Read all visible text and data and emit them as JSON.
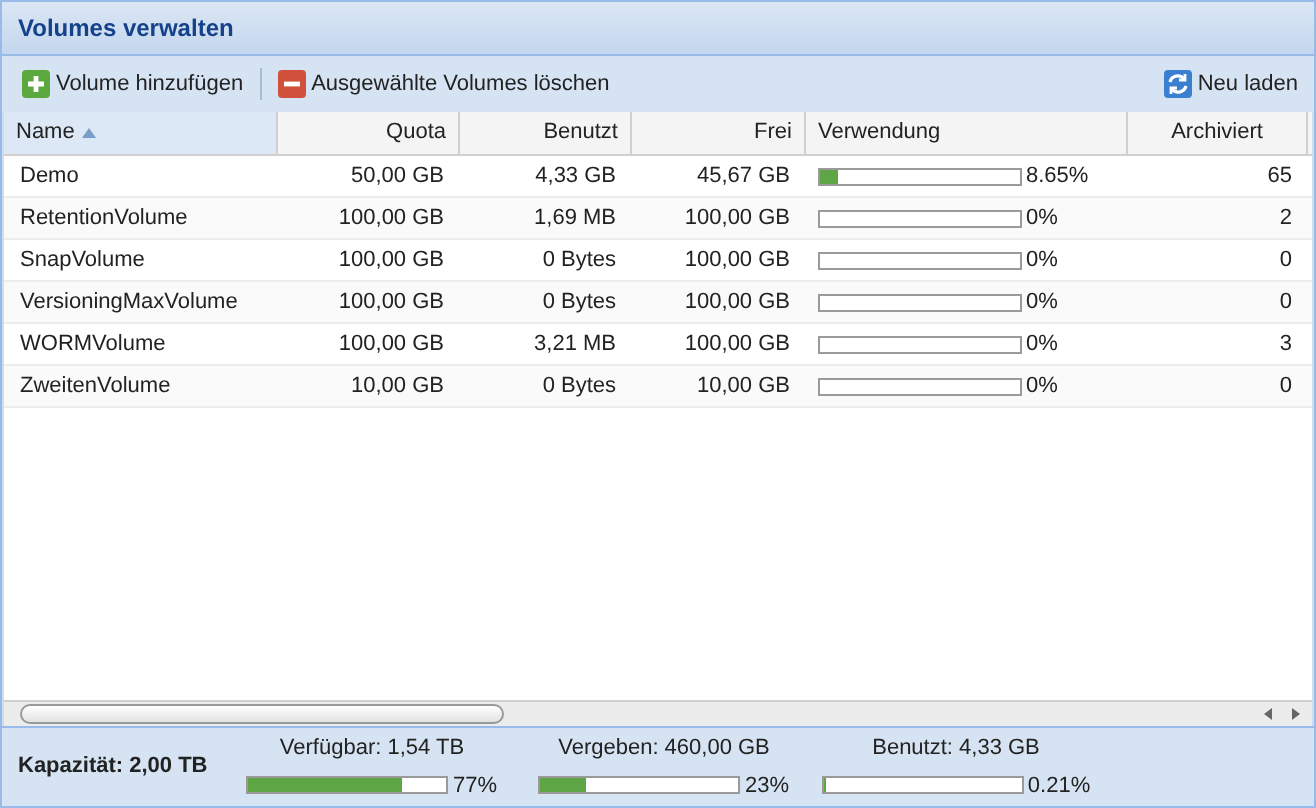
{
  "panel": {
    "title": "Volumes verwalten"
  },
  "toolbar": {
    "buttons": [
      {
        "kind": "add",
        "label": "Volume hinzufügen"
      },
      {
        "kind": "delete",
        "label": "Ausgewählte Volumes löschen"
      }
    ],
    "reload": {
      "label": "Neu laden"
    }
  },
  "table": {
    "columns": [
      {
        "label": "Name",
        "sorted": true
      },
      {
        "label": "Quota",
        "sorted": false
      },
      {
        "label": "Benutzt",
        "sorted": false
      },
      {
        "label": "Frei",
        "sorted": false
      },
      {
        "label": "Verwendung",
        "sorted": false
      },
      {
        "label": "Archiviert",
        "sorted": false
      }
    ],
    "rows": [
      {
        "name": "Demo",
        "quota": "50,00 GB",
        "used": "4,33 GB",
        "free": "45,67 GB",
        "level": 0.0865,
        "usage": "8.65%",
        "archived": "65"
      },
      {
        "name": "RetentionVolume",
        "quota": "100,00 GB",
        "used": "1,69 MB",
        "free": "100,00 GB",
        "usage": "0%",
        "archived": "2"
      },
      {
        "name": "SnapVolume",
        "quota": "100,00 GB",
        "used": "0 Bytes",
        "free": "100,00 GB",
        "usage": "0%",
        "archived": "0"
      },
      {
        "name": "VersioningMaxVolume",
        "quota": "100,00 GB",
        "used": "0 Bytes",
        "free": "100,00 GB",
        "usage": "0%",
        "archived": "0"
      },
      {
        "name": "WORMVolume",
        "quota": "100,00 GB",
        "used": "3,21 MB",
        "free": "100,00 GB",
        "usage": "0%",
        "archived": "3"
      },
      {
        "name": "ZweitenVolume",
        "quota": "10,00 GB",
        "used": "0 Bytes",
        "free": "10,00 GB",
        "usage": "0%",
        "archived": "0"
      }
    ]
  },
  "footer": {
    "capacity": "Kapazität: 2,00 TB",
    "meters": [
      {
        "label": "Verfügbar: 1,54 TB",
        "level": 0.77,
        "reading": "77%"
      },
      {
        "label": "Vergeben: 460,00 GB",
        "level": 0.23,
        "reading": "23%"
      },
      {
        "label": "Benutzt: 4,33 GB",
        "level": 0.0021,
        "reading": "0.21%"
      }
    ]
  }
}
